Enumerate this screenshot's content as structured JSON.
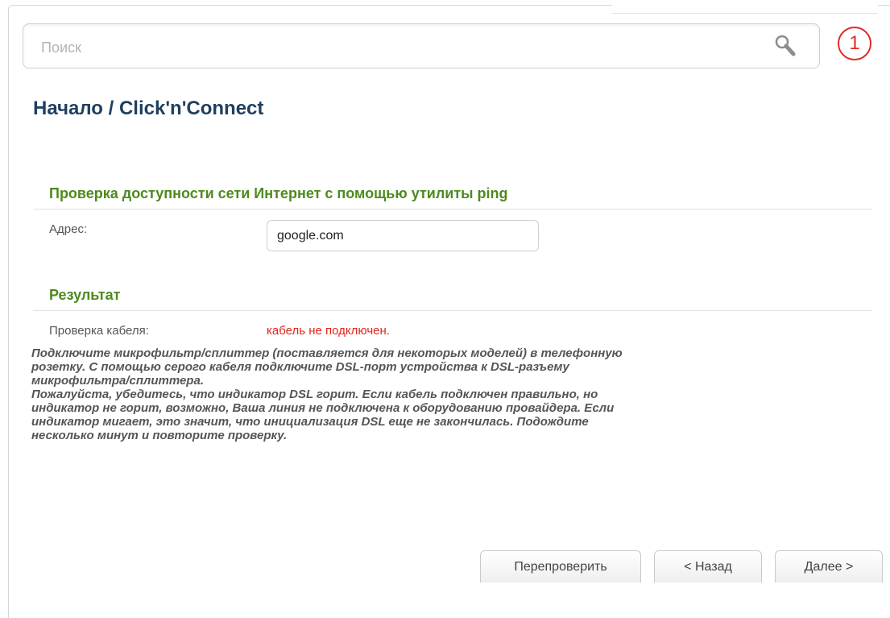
{
  "search": {
    "placeholder": "Поиск"
  },
  "notifications": {
    "count": "1"
  },
  "page": {
    "title": "Начало /  Click'n'Connect"
  },
  "ping_section": {
    "heading": "Проверка доступности сети Интернет с помощью утилиты ping",
    "address_label": "Адрес:",
    "address_value": "google.com"
  },
  "result_section": {
    "heading": "Результат",
    "cable_label": "Проверка кабеля:",
    "cable_status": "кабель не подключен.",
    "hint": "Подключите микрофильтр/сплиттер (поставляется для некоторых моделей) в телефонную\nрозетку. С помощью серого кабеля подключите DSL-порт устройства к DSL-разъему\nмикрофильтра/сплиттера.\nПожалуйста, убедитесь, что индикатор DSL горит. Если кабель подключен правильно, но\nиндикатор не горит, возможно, Ваша линия не подключена к оборудованию провайдера. Если\nиндикатор мигает, это значит, что инициализация DSL еще не закончилась. Подождите\nнесколько минут и повторите проверку."
  },
  "buttons": {
    "recheck": "Перепроверить",
    "back": "< Назад",
    "next": "Далее >"
  },
  "colors": {
    "title": "#1f3f5f",
    "section_heading": "#4e8a1e",
    "error": "#e3261a",
    "notification": "#e22a2a"
  }
}
